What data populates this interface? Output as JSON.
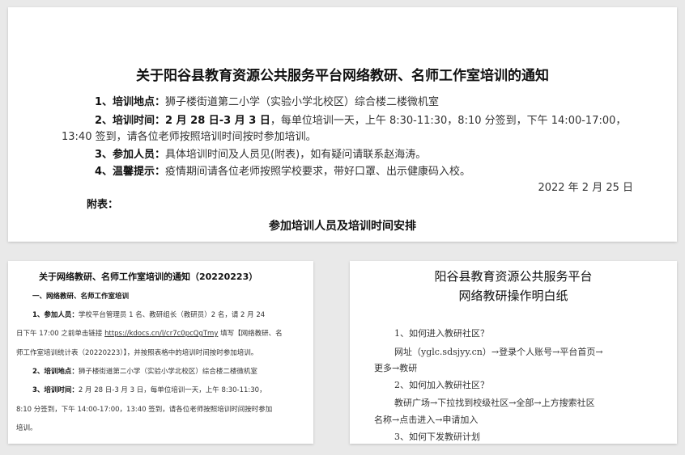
{
  "top": {
    "title": "关于阳谷县教育资源公共服务平台网络教研、名师工作室培训的通知",
    "l1_label": "1、培训地点：",
    "l1_text": "狮子楼街道第二小学（实验小学北校区）综合楼二楼微机室",
    "l2_label": "2、培训时间：",
    "l2_date": "2 月 28 日-3 月 3 日",
    "l2_text": "，每单位培训一天，上午 8:30-11:30，8:10 分签到，下午 14:00-17:00，",
    "l2_cont": "13:40 签到，请各位老师按照培训时间按时参加培训。",
    "l3_label": "3、参加人员：",
    "l3_text": "具体培训时间及人员见(附表)，如有疑问请联系赵海涛。",
    "l4_label": "4、温馨提示：",
    "l4_text": "疫情期间请各位老师按照学校要求，带好口罩、出示健康码入校。",
    "date": "2022 年 2 月 25 日",
    "appendix": "附表：",
    "subtitle": "参加培训人员及培训时间安排"
  },
  "bottom_left": {
    "title": "关于网络教研、名师工作室培训的通知（20220223）",
    "section": "一、网络教研、名师工作室培训",
    "p1_label": "1、参加人员：",
    "p1_a": "学校平台管理员 1 名、教研组长（教研员）2 名，请 2 月 24",
    "p1_b_pre": "日下午 17:00 之前单击链接 ",
    "p1_link": "https://kdocs.cn/l/cr7c0pcQgTmy",
    "p1_b_post": " 填写【网络教研、名",
    "p1_c": "师工作室培训统计表（20220223）】，并按照表格中的培训时间按时参加培训。",
    "p2_label": "2、培训地点：",
    "p2_text": "狮子楼街道第二小学（实验小学北校区）综合楼二楼微机室",
    "p3_label": "3、培训时间：",
    "p3_a": "2 月 28 日-3 月 3 日，每单位培训一天，上午 8:30-11:30，",
    "p3_b": "8:10 分签到，下午 14:00-17:00，13:40 签到，请各位老师按照培训时间按时参加",
    "p3_c": "培训。"
  },
  "bottom_right": {
    "title1": "阳谷县教育资源公共服务平台",
    "title2": "网络教研操作明白纸",
    "q1": "1、如何进入教研社区？",
    "a1a": "网址（yglc.sdsjyy.cn）→登录个人账号→平台首页→",
    "a1b": "更多→教研",
    "q2": "2、如何加入教研社区？",
    "a2a": "教研广场→下拉找到校级社区→全部→上方搜索社区",
    "a2b": "名称→点击进入→申请加入",
    "q3": "3、如何下发教研计划"
  }
}
